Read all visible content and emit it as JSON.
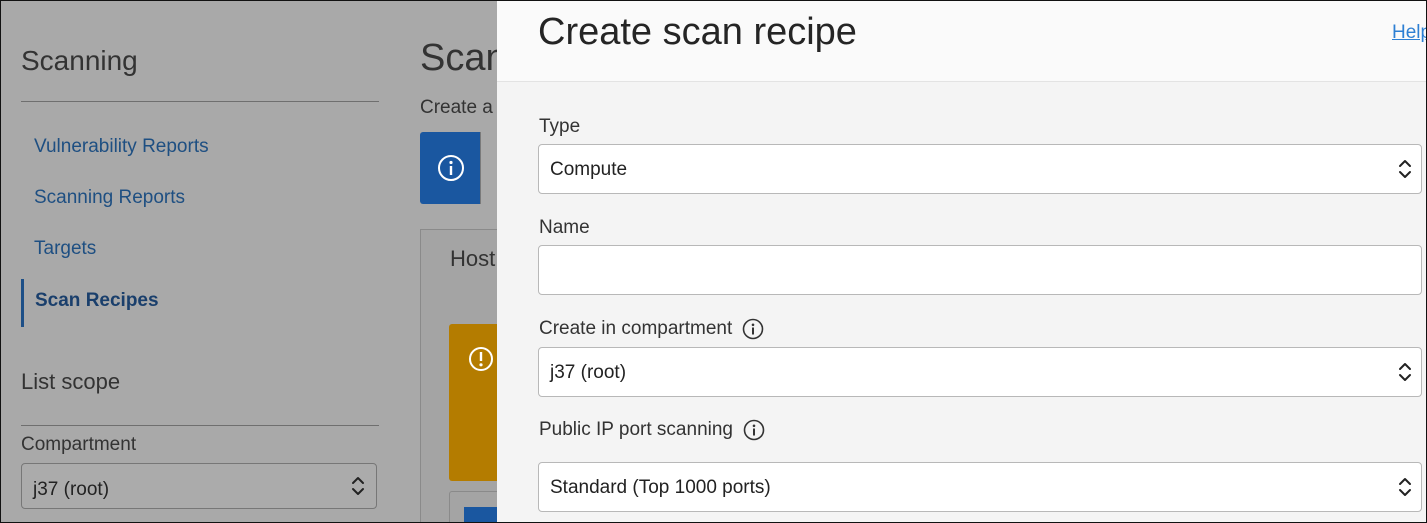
{
  "sidebar": {
    "title": "Scanning",
    "items": [
      {
        "label": "Vulnerability Reports",
        "active": false
      },
      {
        "label": "Scanning Reports",
        "active": false
      },
      {
        "label": "Targets",
        "active": false
      },
      {
        "label": "Scan Recipes",
        "active": true
      }
    ],
    "list_scope": {
      "title": "List scope",
      "compartment_label": "Compartment",
      "compartment_value": "j37 (root)"
    }
  },
  "main": {
    "title_partial": "Scan",
    "subtitle_partial": "Create a",
    "tab_partial": "Host"
  },
  "drawer": {
    "title": "Create scan recipe",
    "help_link": "Help",
    "fields": {
      "type": {
        "label": "Type",
        "value": "Compute"
      },
      "name": {
        "label": "Name",
        "value": "",
        "placeholder": ""
      },
      "compartment": {
        "label": "Create in compartment",
        "value": "j37 (root)"
      },
      "port_scanning": {
        "label": "Public IP port scanning",
        "value": "Standard (Top 1000 ports)"
      }
    }
  },
  "colors": {
    "link": "#1e4f82",
    "accent_blue": "#1a57a0",
    "warning": "#b47c00",
    "help_link": "#2d7fd3"
  },
  "icons": [
    "info-icon",
    "warning-icon",
    "chevron-updown-icon"
  ]
}
